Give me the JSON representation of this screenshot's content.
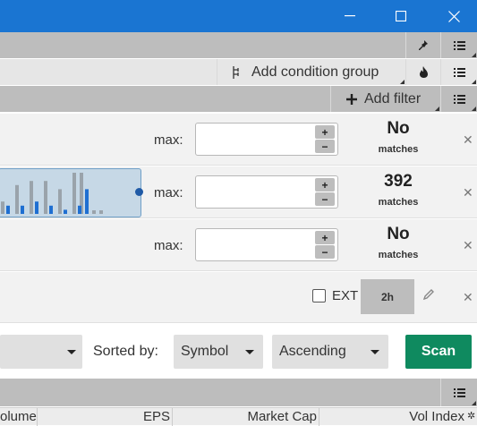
{
  "titlebar": {
    "color": "#1a75d2",
    "minimize": "—",
    "maximize": "☐",
    "close": "✕"
  },
  "toolbar1": {
    "pin_icon": "pin-icon",
    "menu_icon": "menu-icon"
  },
  "toolbar2": {
    "add_condition_group": "Add condition group",
    "flame_icon": "flame-icon"
  },
  "toolbar3": {
    "add_filter": "Add filter"
  },
  "filters": [
    {
      "max_label": "max:",
      "max_value": "",
      "match_count": "No",
      "match_label": "matches"
    },
    {
      "max_label": "max:",
      "max_value": "",
      "match_count": "392",
      "match_label": "matches",
      "histogram": {
        "bars_gray": [
          3,
          7,
          8,
          8,
          6,
          10,
          10
        ],
        "bars_blue": [
          2,
          2,
          3,
          2,
          1,
          2,
          6
        ]
      }
    },
    {
      "max_label": "max:",
      "max_value": "",
      "match_count": "No",
      "match_label": "matches"
    }
  ],
  "ext_row": {
    "ext_label": "EXT",
    "ext_checked": false,
    "timeframe": "2h"
  },
  "sort": {
    "sorted_by_label": "Sorted by:",
    "field": "Symbol",
    "order": "Ascending",
    "scan_button": "Scan",
    "scan_color": "#0f8a5f"
  },
  "results_header": {
    "columns": [
      "olume",
      "EPS",
      "Market Cap",
      "Vol Index"
    ]
  }
}
